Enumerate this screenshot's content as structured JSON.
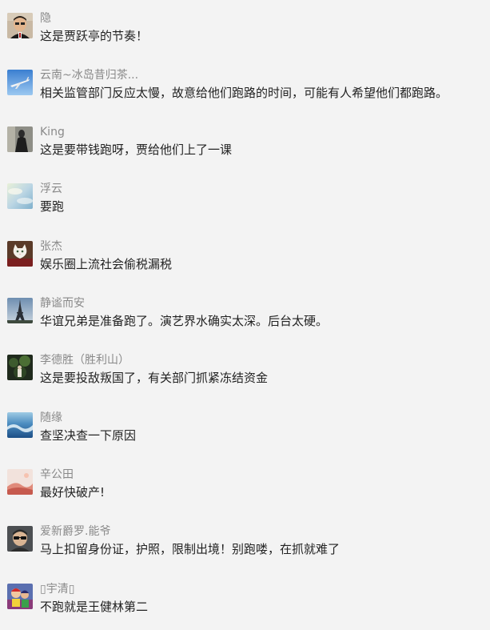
{
  "comments": [
    {
      "nickname": "隐",
      "content": "这是贾跃亭的节奏！",
      "avatar": "portrait-man-glasses"
    },
    {
      "nickname": "云南~冰岛昔归茶...",
      "content": "相关监管部门反应太慢，故意给他们跑路的时间，可能有人希望他们都跑路。",
      "avatar": "airplane-sky"
    },
    {
      "nickname": "King",
      "content": "这是要带钱跑呀，贾给他们上了一课",
      "avatar": "dark-figure"
    },
    {
      "nickname": "浮云",
      "content": "要跑",
      "avatar": "sky-clouds"
    },
    {
      "nickname": "张杰",
      "content": "娱乐圈上流社会偷税漏税",
      "avatar": "white-cat"
    },
    {
      "nickname": "静谧而安",
      "content": "华谊兄弟是准备跑了。演艺界水确实太深。后台太硬。",
      "avatar": "eiffel-tower"
    },
    {
      "nickname": "李德胜（胜利山）",
      "content": "这是要投敌叛国了，有关部门抓紧冻结资金",
      "avatar": "forest-dark"
    },
    {
      "nickname": "随缘",
      "content": "查坚决查一下原因",
      "avatar": "ocean-wave"
    },
    {
      "nickname": "辛公田",
      "content": "最好快破产!",
      "avatar": "pink-landscape"
    },
    {
      "nickname": "爱新爵罗.能爷",
      "content": "马上扣留身份证，护照，限制出境！别跑喽，在抓就难了",
      "avatar": "man-sunglasses"
    },
    {
      "nickname": "宇清",
      "content": "不跑就是王健林第二",
      "avatar": "colorful-cartoon"
    }
  ]
}
